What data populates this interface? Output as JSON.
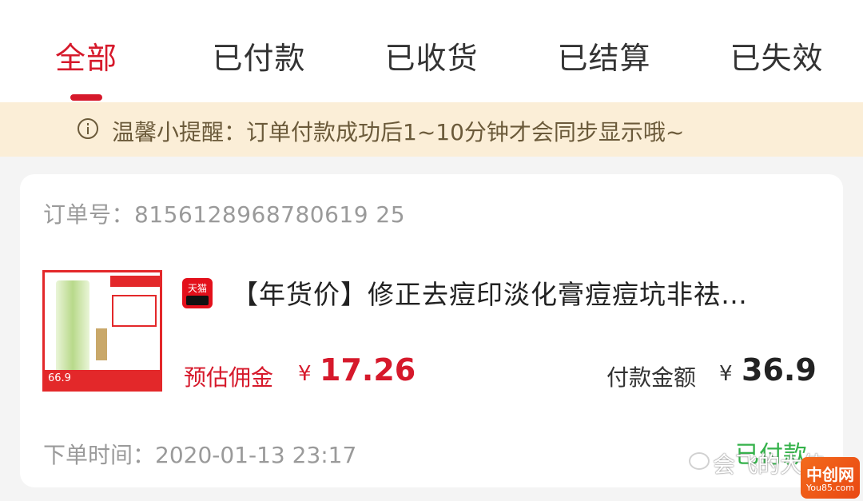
{
  "tabs": [
    {
      "label": "全部"
    },
    {
      "label": "已付款"
    },
    {
      "label": "已收货"
    },
    {
      "label": "已结算"
    },
    {
      "label": "已失效"
    }
  ],
  "notice": {
    "text": "温馨小提醒：订单付款成功后1~10分钟才会同步显示哦~"
  },
  "order": {
    "order_no": "订单号：8156128968780619 25",
    "product": {
      "image_price": "66.9",
      "platform_badge": "天猫",
      "title": "【年货价】修正去痘印淡化膏痘痘坑非祛…"
    },
    "commission_label": "预估佣金",
    "commission_currency": "¥",
    "commission_value": "17.26",
    "pay_label": "付款金额",
    "pay_currency": "¥",
    "pay_value": "36.9",
    "order_time": "下单时间：2020-01-13 23:17",
    "status": "已付款"
  },
  "watermark": {
    "text": "会飞的大侠",
    "logo_text": "中创网",
    "logo_sub": "You85.com"
  },
  "colors": {
    "accent": "#d6192b",
    "notice_bg": "#fbeed7",
    "status_green": "#34b24a"
  }
}
